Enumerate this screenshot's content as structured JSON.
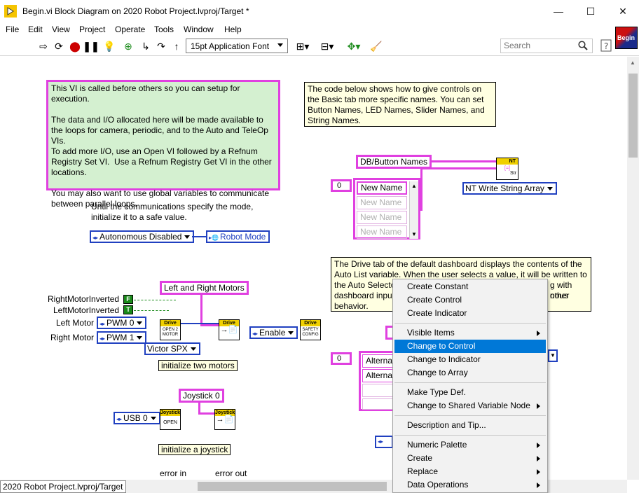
{
  "window": {
    "title": "Begin.vi Block Diagram on 2020 Robot Project.lvproj/Target *",
    "minimize": "—",
    "maximize": "☐",
    "close": "✕"
  },
  "menu": [
    "File",
    "Edit",
    "View",
    "Project",
    "Operate",
    "Tools",
    "Window",
    "Help"
  ],
  "toolbar": {
    "font": "15pt Application Font",
    "search_placeholder": "Search",
    "begin_icon_label": "Begin"
  },
  "diagram": {
    "green_comment": "This VI is called before others so you can setup for execution.\n\nThe data and I/O allocated here will be made available to the loops for camera, periodic, and to the Auto and TeleOp VIs.\nTo add more I/O, use an Open VI followed by a Refnum Registry Set VI.  Use a Refnum Registry Get VI in the other locations.\n\nYou may also want to use global variables to communicate between parallel loops.",
    "names_comment": "The code below shows how to give controls on the Basic tab more specific names. You can set Button Names, LED Names, Slider Names, and String Names.",
    "mode_comment": "Until the communications specify the mode,\ninitialize it to a safe value.",
    "mode_enum": "Autonomous Disabled",
    "robot_mode": "Robot Mode",
    "db_button_names": "DB/Button Names",
    "array_index": "0",
    "array_items": [
      "New Name",
      "New Name",
      "New Name",
      "New Name"
    ],
    "nt_label": "NT",
    "nt_str": "Str",
    "nt_write": "NT Write String Array",
    "drive_comment": "The Drive tab of the default dashboard displays the contents of the Auto List variable. When the user selects a value, it will be written to the Auto Selector ... with other dashboard input... ous behavior.",
    "drive_comment_lines": [
      "The Drive tab of the default dashboard displays the contents of the",
      "Auto List variable. When the user selects a value, it will be written to",
      "the Auto Selector",
      "dashboard input",
      "behavior."
    ],
    "drive_comment_right": [
      "g with other",
      "nous"
    ],
    "left_right_motors": "Left and Right Motors",
    "right_motor_inverted": "RightMotorInverted",
    "left_motor_inverted": "LeftMotorInverted",
    "left_motor": "Left Motor",
    "right_motor": "Right Motor",
    "pwm0": "PWM 0",
    "pwm1": "PWM 1",
    "bool_false": "F",
    "bool_true": "T",
    "victor": "Victor SPX",
    "enable": "Enable",
    "init_two_motors": "initialize two motors",
    "drive_hdr": "Drive",
    "open_2motor": "OPEN 2 MOTOR",
    "safety_config": "SAFETY CONFIG",
    "joystick0": "Joystick 0",
    "usb0": "USB 0",
    "joystick_hdr": "Joystick",
    "open": "OPEN",
    "init_joystick": "initialize a joystick",
    "error_in": "error in",
    "error_out": "error out",
    "alt_items": [
      "Alternat",
      "Alternat"
    ],
    "alt_index": "0"
  },
  "context_menu": {
    "items": [
      {
        "label": "Create Constant",
        "submenu": false
      },
      {
        "label": "Create Control",
        "submenu": false
      },
      {
        "label": "Create Indicator",
        "submenu": false
      },
      {
        "sep": true
      },
      {
        "label": "Visible Items",
        "submenu": true
      },
      {
        "label": "Change to Control",
        "submenu": false,
        "selected": true
      },
      {
        "label": "Change to Indicator",
        "submenu": false
      },
      {
        "label": "Change to Array",
        "submenu": false
      },
      {
        "sep": true
      },
      {
        "label": "Make Type Def.",
        "submenu": false
      },
      {
        "label": "Change to Shared Variable Node",
        "submenu": true
      },
      {
        "sep": true
      },
      {
        "label": "Description and Tip...",
        "submenu": false
      },
      {
        "sep": true
      },
      {
        "label": "Numeric Palette",
        "submenu": true
      },
      {
        "label": "Create",
        "submenu": true
      },
      {
        "label": "Replace",
        "submenu": true
      },
      {
        "label": "Data Operations",
        "submenu": true
      }
    ]
  },
  "status": {
    "context_path": "2020 Robot Project.lvproj/Target"
  }
}
